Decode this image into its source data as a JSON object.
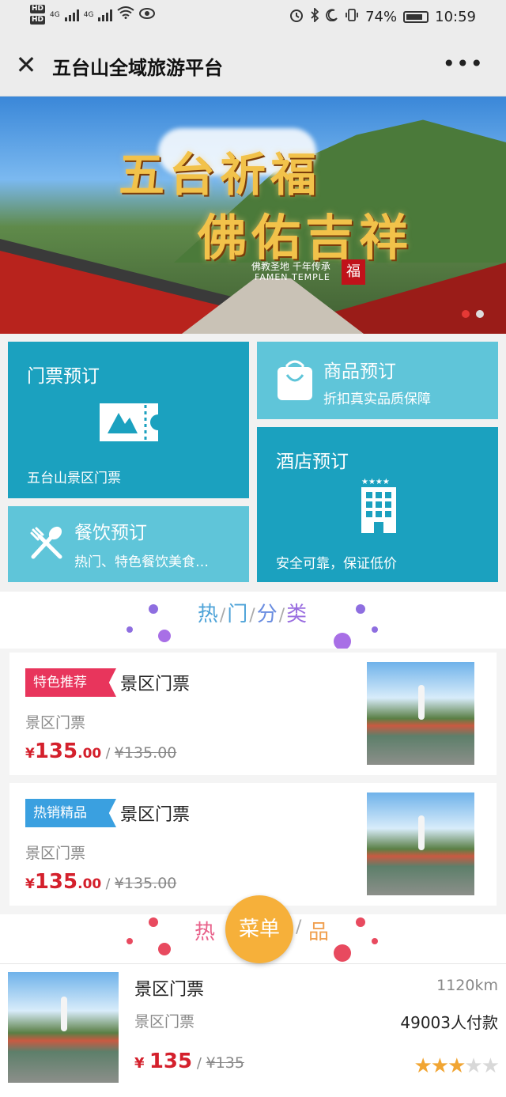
{
  "status_bar": {
    "hd1": "HD",
    "hd2": "HD",
    "net1": "4G",
    "net2": "4G",
    "battery": "74%",
    "time": "10:59"
  },
  "nav": {
    "title": "五台山全域旅游平台",
    "close_icon": "close-icon",
    "more_icon": "more-icon"
  },
  "banner": {
    "line1": "五台祈福",
    "line2": "佛佑吉祥",
    "subtitle": "佛教圣地 千年传承",
    "subtitle2": "FAMEN TEMPLE",
    "seal": "福",
    "slides": 2,
    "active_slide": 1
  },
  "tiles": {
    "ticket": {
      "title": "门票预订",
      "subtitle": "五台山景区门票",
      "icon": "ticket-icon"
    },
    "shop": {
      "title": "商品预订",
      "subtitle": "折扣真实品质保障",
      "icon": "shopping-bag-icon"
    },
    "hotel": {
      "title": "酒店预订",
      "subtitle": "安全可靠，保证低价",
      "icon": "hotel-icon"
    },
    "food": {
      "title": "餐饮预订",
      "subtitle": "热门、特色餐饮美食…",
      "icon": "fork-knife-icon"
    }
  },
  "hot_category": {
    "title_chars": [
      "热",
      "门",
      "分",
      "类"
    ],
    "items": [
      {
        "badge": "特色推荐",
        "name": "景区门票",
        "desc": "景区门票",
        "currency": "¥",
        "price_int": "135",
        "price_dec": ".00",
        "sep": " / ",
        "old_price": "¥135.00"
      },
      {
        "badge": "热销精品",
        "name": "景区门票",
        "desc": "景区门票",
        "currency": "¥",
        "price_int": "135",
        "price_dec": ".00",
        "sep": " / ",
        "old_price": "¥135.00"
      }
    ]
  },
  "hot_product": {
    "title_left": "热",
    "title_right": "品",
    "sep": "/"
  },
  "menu_button": "菜单",
  "list_item": {
    "name": "景区门票",
    "desc": "景区门票",
    "distance": "1120km",
    "paid": "49003人付款",
    "currency": "¥",
    "price": "135",
    "sep": " / ",
    "old_price": "¥135",
    "rating": 3,
    "rating_max": 5
  },
  "colors": {
    "tile_dark": "#1ba1bf",
    "tile_light": "#5fc5d9",
    "price_red": "#d4202c",
    "badge_red": "#e8355c",
    "badge_blue": "#3aa0e0",
    "menu_orange": "#f6b03a",
    "star_orange": "#f1a533"
  }
}
